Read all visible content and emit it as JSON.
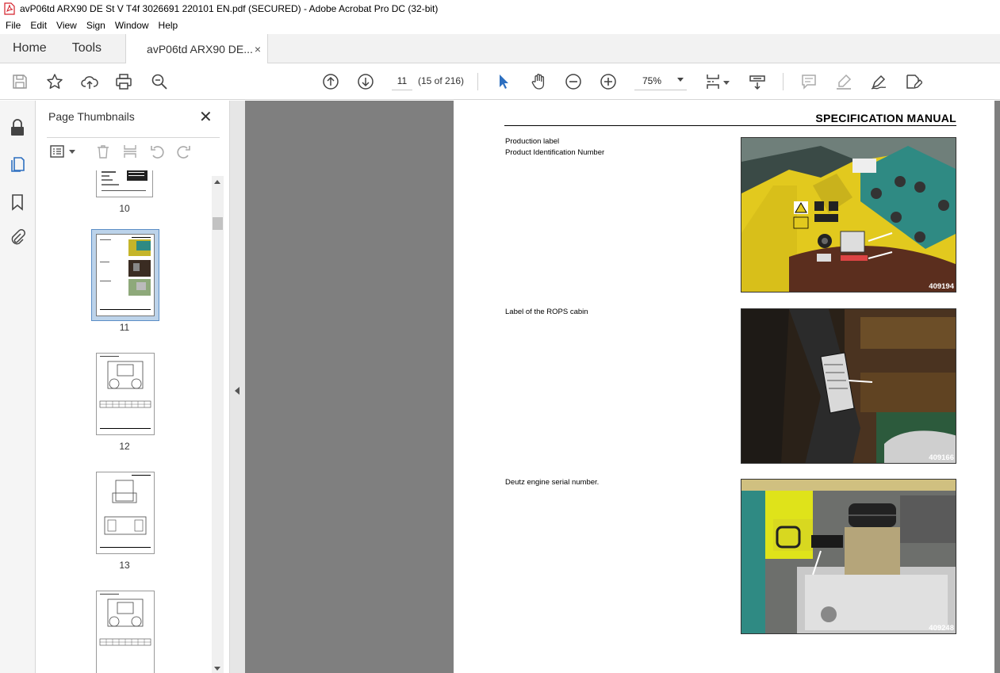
{
  "window": {
    "title": "avP06td ARX90 DE St V T4f 3026691 220101 EN.pdf (SECURED) - Adobe Acrobat Pro DC (32-bit)"
  },
  "menu": [
    "File",
    "Edit",
    "View",
    "Sign",
    "Window",
    "Help"
  ],
  "tabs": {
    "home": "Home",
    "tools": "Tools",
    "document": "avP06td ARX90 DE...",
    "close_symbol": "×"
  },
  "toolbar": {
    "current_page": "11",
    "page_count": "(15 of 216)",
    "zoom": "75%"
  },
  "thumbnails_panel": {
    "title": "Page Thumbnails",
    "close_symbol": "✕",
    "pages": [
      {
        "label": "10"
      },
      {
        "label": "11",
        "selected": true
      },
      {
        "label": "12"
      },
      {
        "label": "13"
      },
      {
        "label": ""
      }
    ]
  },
  "document": {
    "header": "SPECIFICATION MANUAL",
    "sections": [
      {
        "caption_lines": [
          "Production label",
          "Product Identification Number"
        ],
        "photo_id": "409194"
      },
      {
        "caption_lines": [
          "Label of the ROPS cabin"
        ],
        "photo_id": "409166"
      },
      {
        "caption_lines": [
          "Deutz engine serial number."
        ],
        "photo_id": "409248"
      }
    ]
  },
  "colors": {
    "accent_blue": "#2d6fc0",
    "selection": "#bcd3ea",
    "doc_background": "#7f7f7f"
  }
}
